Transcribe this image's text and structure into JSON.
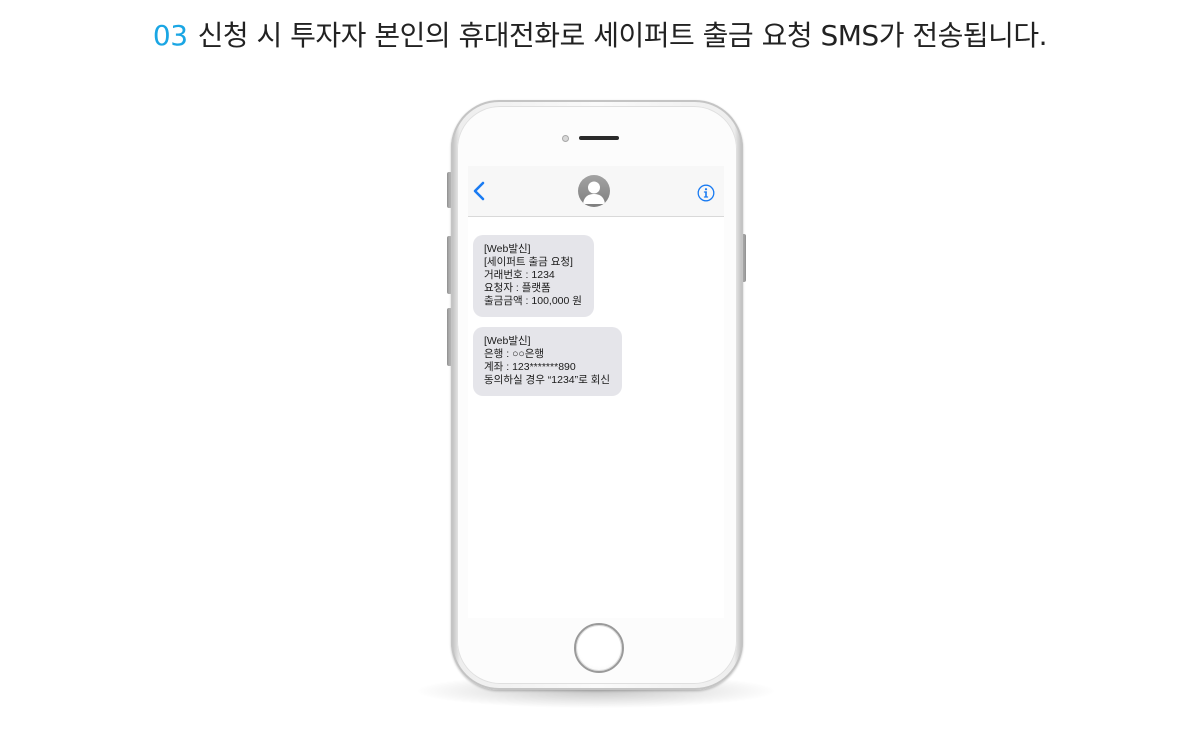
{
  "header": {
    "step_number": "03",
    "step_text": "신청 시 투자자 본인의 휴대전화로 세이퍼트 출금 요청 SMS가 전송됩니다."
  },
  "colors": {
    "step_number": "#1aa6e4",
    "bubble_background": "#e5e5ea",
    "ios_blue": "#1a7bf2"
  },
  "phone": {
    "nav": {
      "back_icon": "chevron-left-icon",
      "avatar_icon": "contact-avatar-icon",
      "info_icon": "info-circle-icon"
    },
    "messages": [
      {
        "lines": [
          "[Web발신]",
          "[세이퍼트 출금 요청]",
          "거래번호 : 1234",
          "요청자 : 플랫폼",
          "출금금액 : 100,000 원"
        ]
      },
      {
        "lines": [
          "[Web발신]",
          "은행 : ○○은행",
          "계좌 : 123*******890",
          "동의하실 경우 “1234”로 회신"
        ]
      }
    ]
  }
}
